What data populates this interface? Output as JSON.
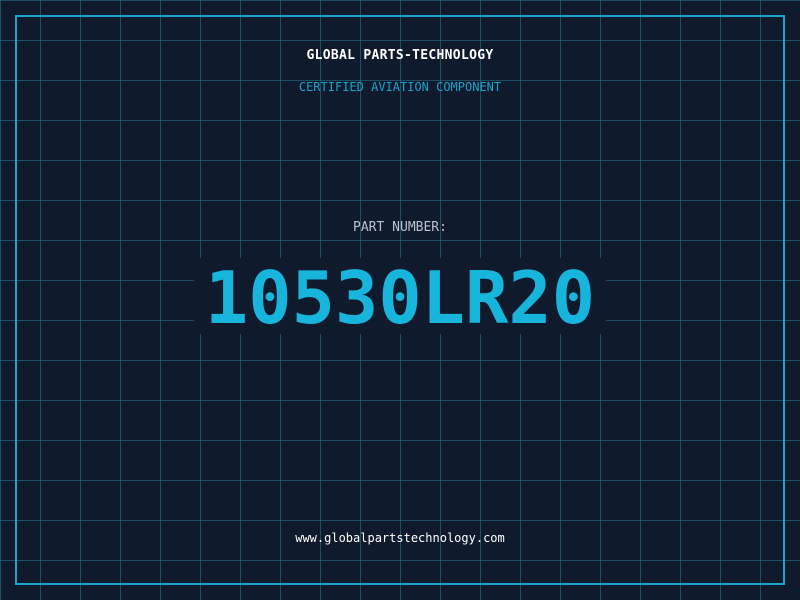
{
  "header": {
    "company_name": "GLOBAL PARTS-TECHNOLOGY",
    "subtitle": "CERTIFIED AVIATION COMPONENT"
  },
  "part": {
    "label": "PART NUMBER:",
    "number": "10530LR20"
  },
  "footer": {
    "website": "www.globalpartstechnology.com"
  },
  "colors": {
    "background": "#0f1a2c",
    "grid": "#28788f",
    "accent": "#1aa3cc",
    "part_number": "#17b4dc",
    "label": "#b9c3cf",
    "text": "#ffffff"
  }
}
